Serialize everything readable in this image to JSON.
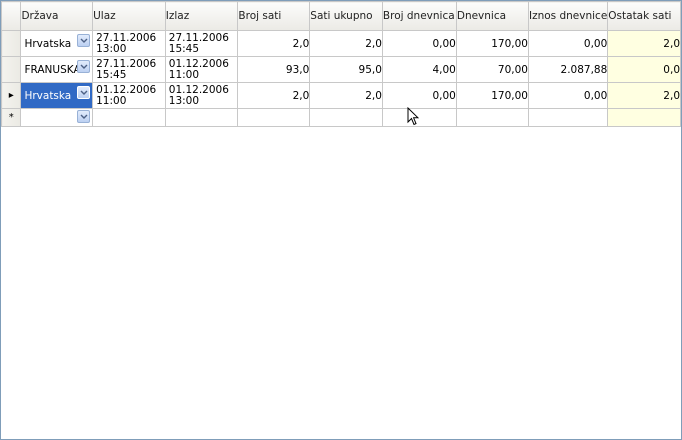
{
  "columns": [
    {
      "key": "drzava",
      "label": "Država"
    },
    {
      "key": "ulaz",
      "label": "Ulaz"
    },
    {
      "key": "izlaz",
      "label": "Izlaz"
    },
    {
      "key": "broj_sati",
      "label": "Broj sati"
    },
    {
      "key": "sati_ukupno",
      "label": "Sati ukupno"
    },
    {
      "key": "broj_dnevnica",
      "label": "Broj dnevnica"
    },
    {
      "key": "dnevnica",
      "label": "Dnevnica"
    },
    {
      "key": "iznos_dnevnice",
      "label": "Iznos dnevnice"
    },
    {
      "key": "ostatak_sati",
      "label": "Ostatak sati"
    }
  ],
  "rows": [
    {
      "drzava": "Hrvatska",
      "ulaz_date": "27.11.2006",
      "ulaz_time": "13:00",
      "izlaz_date": "27.11.2006",
      "izlaz_time": "15:45",
      "broj_sati": "2,0",
      "sati_ukupno": "2,0",
      "broj_dnevnica": "0,00",
      "dnevnica": "170,00",
      "iznos_dnevnice": "0,00",
      "ostatak_sati": "2,0"
    },
    {
      "drzava": "FRANUSKA",
      "ulaz_date": "27.11.2006",
      "ulaz_time": "15:45",
      "izlaz_date": "01.12.2006",
      "izlaz_time": "11:00",
      "broj_sati": "93,0",
      "sati_ukupno": "95,0",
      "broj_dnevnica": "4,00",
      "dnevnica": "70,00",
      "iznos_dnevnice": "2.087,88",
      "ostatak_sati": "0,0"
    },
    {
      "drzava": "Hrvatska",
      "ulaz_date": "01.12.2006",
      "ulaz_time": "11:00",
      "izlaz_date": "01.12.2006",
      "izlaz_time": "13:00",
      "broj_sati": "2,0",
      "sati_ukupno": "2,0",
      "broj_dnevnica": "0,00",
      "dnevnica": "170,00",
      "iznos_dnevnice": "0,00",
      "ostatak_sati": "2,0"
    }
  ],
  "current_row_indicator": "▸",
  "new_row_indicator": "*",
  "icons": {
    "dropdown": "chevron-down-icon",
    "cursor": "mouse-pointer-icon"
  },
  "colors": {
    "selection": "#316ac5",
    "ostatak_bg": "#ffffe1",
    "header_bg": "#ebeae5"
  }
}
